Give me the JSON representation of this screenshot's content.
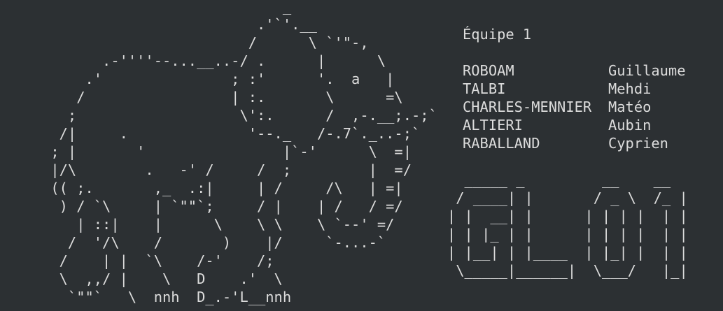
{
  "colors": {
    "background": "#2c3033",
    "text": "#dcdcdc"
  },
  "ascii_art": {
    "elephant": "                                _\n                             .'`'.__\n                            /      \\ `'\"-,\n           .-''''--...__..-/ .      |      \\\n         .'               ; :'      '.  a   |\n        /                 | :.       \\      =\\\n       ;                   \\':.      /  ,-.__;.-;`\n      /|     .              '--._   /-.7`._..-;`\n     ; |       '                |`-'      \\  =|\n     |/\\        .   -' /     /  ;         |  =/\n     (( ;.       ,_  .:|     | /     /\\   | =|\n      ) / `\\     | `\"\"`;     / |    | /   / =/\n        | ::|    |      \\    \\ \\    \\ `--' =/\n       /  '/\\    /       )    |/     `-...-`\n      /    | |  `\\    /-'    /;\n      \\  ,,/ |    \\   D    .'  \\\n       `\"\"`   \\  nnh  D_.-'L__nnh",
    "logo": "  _____ _         __    __ \n / ____| |       / _ \\  /_ |\n| |  __| |      | | | |  | |\n| | |_ | |      | | | |  | |\n| |__| | |____  | |_| |  | |\n \\_____|______|  \\___/   |_|"
  },
  "team": {
    "title": "Équipe 1",
    "members": [
      {
        "last_name": "ROBOAM",
        "first_name": "Guillaume"
      },
      {
        "last_name": "TALBI",
        "first_name": "Mehdi"
      },
      {
        "last_name": "CHARLES-MENNIER",
        "first_name": "Matéo"
      },
      {
        "last_name": "ALTIERI",
        "first_name": "Aubin"
      },
      {
        "last_name": "RABALLAND",
        "first_name": "Cyprien"
      }
    ]
  }
}
